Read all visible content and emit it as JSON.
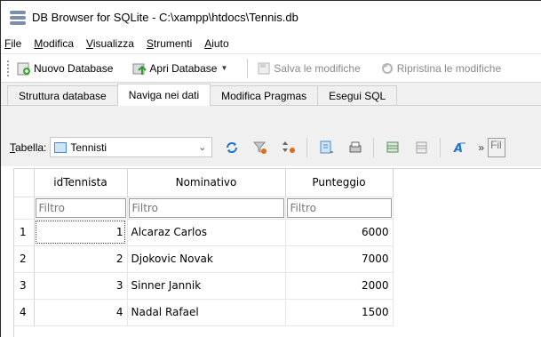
{
  "window": {
    "title": "DB Browser for SQLite - C:\\xampp\\htdocs\\Tennis.db"
  },
  "menu": [
    {
      "label": "File",
      "u": "F",
      "rest": "ile"
    },
    {
      "label": "Modifica",
      "u": "M",
      "rest": "odifica"
    },
    {
      "label": "Visualizza",
      "u": "V",
      "rest": "isualizza"
    },
    {
      "label": "Strumenti",
      "u": "S",
      "rest": "trumenti"
    },
    {
      "label": "Aiuto",
      "u": "A",
      "rest": "iuto"
    }
  ],
  "toolbar": {
    "new_db": "Nuovo Database",
    "open_db": "Apri Database",
    "save": "Salva le modifiche",
    "revert": "Ripristina le modifiche"
  },
  "tabs": [
    {
      "label": "Struttura database",
      "active": false
    },
    {
      "label": "Naviga nei dati",
      "active": true
    },
    {
      "label": "Modifica Pragmas",
      "active": false
    },
    {
      "label": "Esegui SQL",
      "active": false
    }
  ],
  "browse": {
    "table_label_u": "T",
    "table_label_rest": "abella:",
    "table_selected": "Tennisti",
    "more": "»",
    "filter_partial": "Fil"
  },
  "grid": {
    "columns": [
      "idTennista",
      "Nominativo",
      "Punteggio"
    ],
    "filter_placeholder": "Filtro",
    "rows": [
      {
        "num": "1",
        "id": "1",
        "name": "Alcaraz Carlos",
        "score": "6000"
      },
      {
        "num": "2",
        "id": "2",
        "name": "Djokovic Novak",
        "score": "7000"
      },
      {
        "num": "3",
        "id": "3",
        "name": "Sinner Jannik",
        "score": "2000"
      },
      {
        "num": "4",
        "id": "4",
        "name": "Nadal Rafael",
        "score": "1500"
      }
    ]
  },
  "colors": {
    "accent": "#1e73d2",
    "disabled_text": "#8a8a8a",
    "window_bg": "#f0f0f0"
  }
}
